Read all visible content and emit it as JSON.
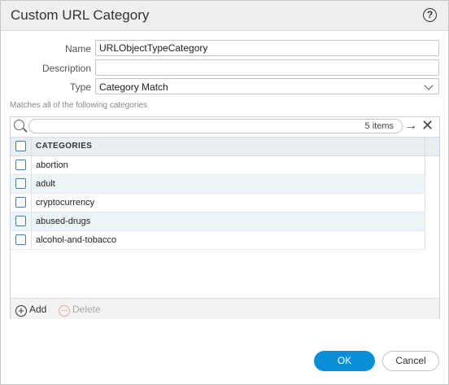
{
  "dialog": {
    "title": "Custom URL Category",
    "help_icon_text": "?"
  },
  "form": {
    "name_label": "Name",
    "name_value": "URLObjectTypeCategory",
    "description_label": "Description",
    "description_value": "",
    "type_label": "Type",
    "type_value": "Category Match"
  },
  "hint": "Matches all of the following categories",
  "grid": {
    "items_count": "5 items",
    "column_header": "CATEGORIES",
    "rows": [
      {
        "label": "abortion"
      },
      {
        "label": "adult"
      },
      {
        "label": "cryptocurrency"
      },
      {
        "label": "abused-drugs"
      },
      {
        "label": "alcohol-and-tobacco"
      }
    ],
    "add_label": "Add",
    "delete_label": "Delete"
  },
  "footer": {
    "ok_label": "OK",
    "cancel_label": "Cancel"
  },
  "colors": {
    "primary_button": "#0a8fd6",
    "checkbox_border": "#3b7ec4",
    "alt_row": "#eef5f8"
  }
}
